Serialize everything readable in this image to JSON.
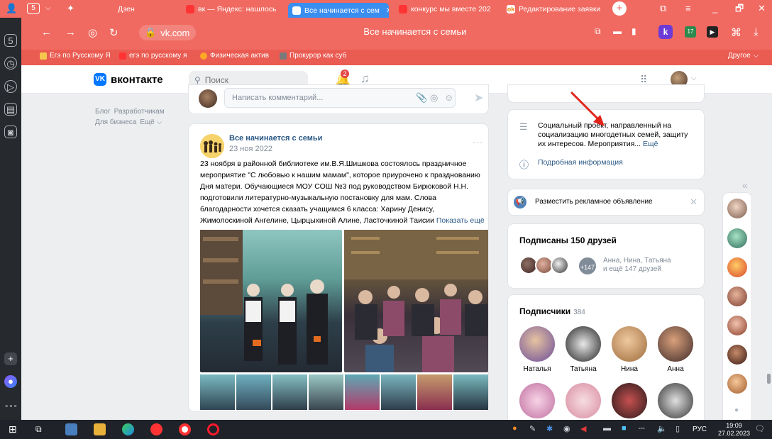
{
  "browser": {
    "tabs": [
      {
        "label": "Дзен",
        "icon": "dzen-icon"
      },
      {
        "label": "вк — Яндекс: нашлось",
        "icon": "yandex-icon"
      },
      {
        "label": "Все начинается с сем",
        "icon": "vk-icon",
        "active": true
      },
      {
        "label": "конкурс мы вместе 202",
        "icon": "yandex-icon"
      },
      {
        "label": "Редактирование заявки",
        "icon": "ok-icon"
      }
    ],
    "tab_count": "5",
    "url": "vk.com",
    "page_title": "Все начинается с семьи",
    "bookmarks": [
      {
        "label": "Егэ по Русскому Я",
        "color": "#f5c74c"
      },
      {
        "label": "егэ по русскому я",
        "color": "#ff3333"
      },
      {
        "label": "Физическая актив",
        "color": "#ffa726"
      },
      {
        "label": "Прокурор как суб",
        "color": "#7a7a7a"
      }
    ],
    "bookmarks_other": "Другое"
  },
  "vk": {
    "logo": "вконтакте",
    "logo_mark": "VK",
    "search_placeholder": "Поиск",
    "notifications_count": "2"
  },
  "left_footer": {
    "links_row1": [
      "Блог",
      "Разработчикам"
    ],
    "links_row2": [
      "Для бизнеса",
      "Ещё ⌵"
    ]
  },
  "comment": {
    "placeholder": "Написать комментарий..."
  },
  "post": {
    "author": "Все начинается с семьи",
    "date": "23 ноя 2022",
    "text": "23 ноября в районной библиотеке им.В.Я.Шишкова состоялось праздничное мероприятие \"С любовью к нашим мамам\", которое приурочено к празднованию Дня матери. Обучающиеся МОУ СОШ №3 под руководством Бирюковой Н.Н. подготовили литературно-музыкальную постановку для мам. Слова благодарности хочется сказать учащимся 6 класса: Харину Денису, Жимолоскиной Ангелине, Цырцыхиной Алине, Ласточкиной Таисии",
    "show_more": "Показать ещё"
  },
  "info": {
    "description": "Социальный проект, направленный на социализацию многодетных семей, защиту их интересов. Мероприятия...",
    "more": "Ещё",
    "details_link": "Подробная информация"
  },
  "ad": {
    "label": "Разместить рекламное объявление"
  },
  "friends": {
    "title": "Подписаны 150 друзей",
    "more_count": "+147",
    "names_line1": "Анна, Нина, Татьяна",
    "names_line2": "и ещё 147 друзей"
  },
  "subscribers": {
    "title": "Подписчики",
    "count": "384",
    "people": [
      "Наталья",
      "Татьяна",
      "Нина",
      "Анна"
    ]
  },
  "taskbar": {
    "lang": "РУС",
    "time": "19:09",
    "date": "27.02.2023"
  },
  "colors": {
    "browser_accent": "#f06a61",
    "vk_blue": "#0077ff",
    "link": "#2a5885",
    "annotation_arrow": "#e2231a"
  }
}
